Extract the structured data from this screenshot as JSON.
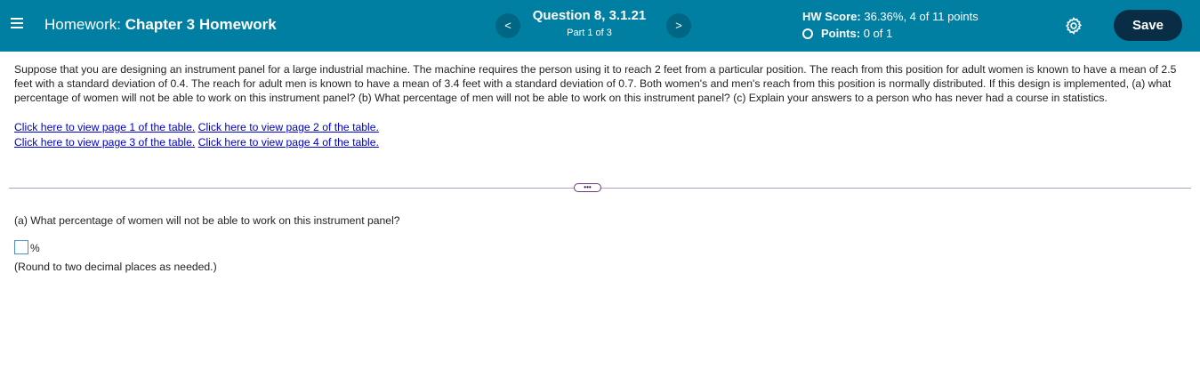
{
  "header": {
    "label": "Homework:",
    "title": "Chapter 3 Homework",
    "prev_label": "<",
    "next_label": ">",
    "question_title": "Question 8, 3.1.21",
    "part": "Part 1 of 3",
    "score_label": "HW Score:",
    "score_value": "36.36%, 4 of 11 points",
    "points_label": "Points:",
    "points_value": "0 of 1",
    "save_label": "Save",
    "menu_icon": "hamburger-menu-icon",
    "settings_icon": "gear-icon",
    "colors": {
      "bar": "#007fa3",
      "save": "#0a2d46"
    }
  },
  "question": {
    "text": "Suppose that you are designing an instrument panel for a large industrial machine. The machine requires the person using it to reach 2 feet from a particular position. The reach from this position for adult women is known to have a mean of 2.5 feet with a standard deviation of 0.4. The reach for adult men is known to have a mean of 3.4 feet with a standard deviation of 0.7. Both women's and men's reach from this position is normally distributed. If this design is implemented, (a) what percentage of women will not be able to work on this instrument panel? (b) What percentage of men will not be able to work on this instrument panel? (c) Explain your answers to a person who has never had a course in statistics.",
    "links": [
      "Click here to view page 1 of the table.",
      "Click here to view page 2 of the table.",
      "Click here to view page 3 of the table.",
      "Click here to view page 4 of the table."
    ],
    "more_label": "•••"
  },
  "part_a": {
    "prompt": "(a) What percentage of women will not be able to work on this instrument panel?",
    "answer_value": "",
    "unit": "%",
    "hint": "(Round to two decimal places as needed.)"
  }
}
